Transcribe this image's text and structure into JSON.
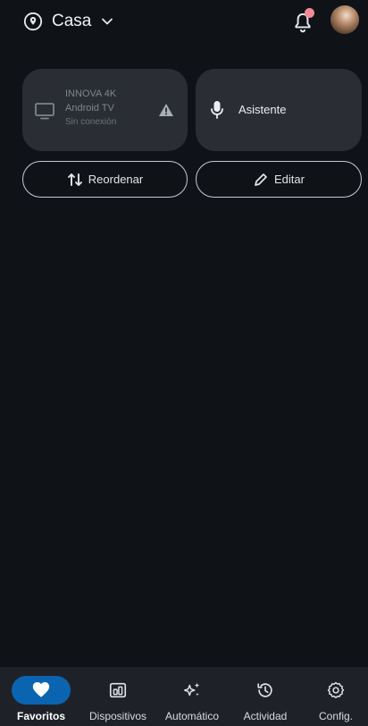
{
  "header": {
    "home_name": "Casa"
  },
  "favorites": {
    "tv_card": {
      "line1": "INNOVA 4K",
      "line2": "Android TV",
      "status": "Sin conexión"
    },
    "assistant_card": {
      "label": "Asistente"
    }
  },
  "actions": {
    "reorder_label": "Reordenar",
    "edit_label": "Editar"
  },
  "bottom_nav": {
    "items": [
      {
        "label": "Favoritos",
        "icon": "heart-icon",
        "active": true
      },
      {
        "label": "Dispositivos",
        "icon": "devices-icon",
        "active": false
      },
      {
        "label": "Automático",
        "icon": "sparkle-icon",
        "active": false
      },
      {
        "label": "Actividad",
        "icon": "history-icon",
        "active": false
      },
      {
        "label": "Config.",
        "icon": "gear-icon",
        "active": false
      }
    ]
  },
  "colors": {
    "background": "#0f1217",
    "card": "#2a2e34",
    "nav_bar": "#1e2228",
    "active_pill": "#0b64b0",
    "notification_dot": "#f28b95"
  }
}
